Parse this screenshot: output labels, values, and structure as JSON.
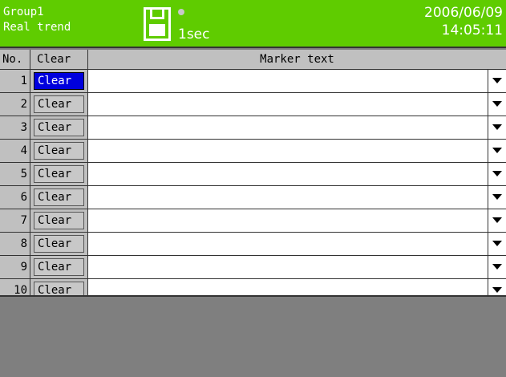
{
  "header": {
    "group": "Group1",
    "mode": "Real trend",
    "interval": "1sec",
    "date": "2006/06/09",
    "time": "14:05:11",
    "icons": [
      "floppy-disk-icon",
      "record-status-dot"
    ]
  },
  "table": {
    "columns": {
      "no": "No.",
      "clear": "Clear",
      "text": "Marker text"
    },
    "rows": [
      {
        "no": "1",
        "clear": "Clear",
        "text": "",
        "selected": true
      },
      {
        "no": "2",
        "clear": "Clear",
        "text": ""
      },
      {
        "no": "3",
        "clear": "Clear",
        "text": ""
      },
      {
        "no": "4",
        "clear": "Clear",
        "text": ""
      },
      {
        "no": "5",
        "clear": "Clear",
        "text": ""
      },
      {
        "no": "6",
        "clear": "Clear",
        "text": ""
      },
      {
        "no": "7",
        "clear": "Clear",
        "text": ""
      },
      {
        "no": "8",
        "clear": "Clear",
        "text": ""
      },
      {
        "no": "9",
        "clear": "Clear",
        "text": ""
      },
      {
        "no": "10",
        "clear": "Clear",
        "text": ""
      }
    ]
  },
  "colors": {
    "header_bg": "#5fcc00",
    "selected_bg": "#0000dd",
    "panel_bg": "#c0c0c0",
    "empty_bg": "#7f7f7f"
  }
}
